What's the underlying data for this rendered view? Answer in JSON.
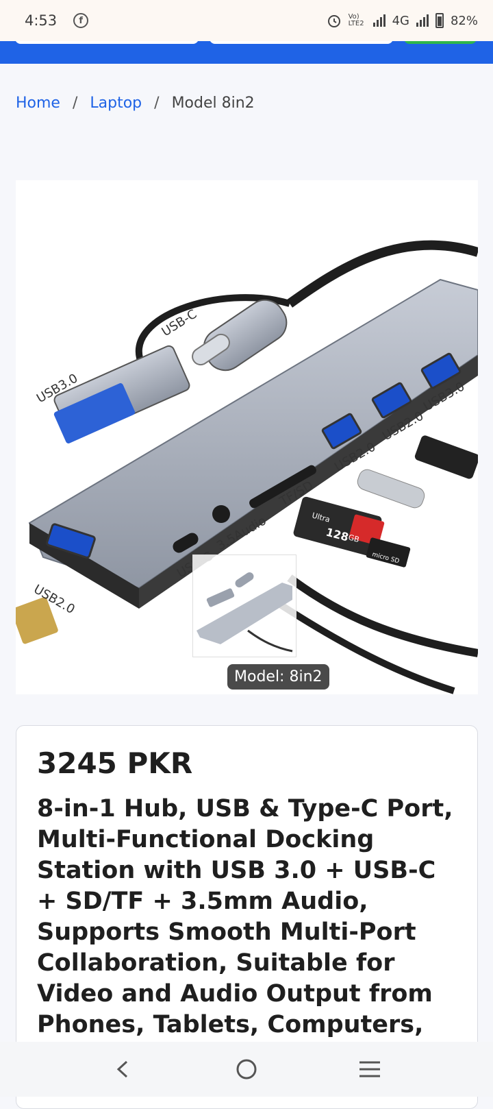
{
  "status": {
    "time": "4:53",
    "fb": "f",
    "volte": "Vo) LTE2",
    "network": "4G",
    "battery": "82%"
  },
  "breadcrumb": {
    "home": "Home",
    "laptop": "Laptop",
    "current": "Model 8in2",
    "sep": "/"
  },
  "product": {
    "image_labels": {
      "usb3_plug": "USB3.0",
      "usbc_plug": "USB-C",
      "port_usb2_left": "USB2.0",
      "port_usbc": "USB-C",
      "port_audio": "3.5Audio",
      "port_tfsd": "TF/SD",
      "port_usb2_a": "USB2.0",
      "port_usb2_b": "USB2.0",
      "port_usb3": "USB3.0",
      "sd_brand": "Ultra",
      "sd_size": "128",
      "sd_unit": "GB",
      "microsd": "micro SD"
    },
    "model_badge": "Model: 8in2",
    "price": "3245 PKR",
    "title": "8-in-1 Hub, USB & Type-C Port, Multi-Functional Docking Station with USB 3.0 + USB-C + SD/TF + 3.5mm Audio, Supports Smooth Multi-Port Collaboration, Suitable for Video and Audio Output from Phones, Tablets, Computers, Etc"
  },
  "nav": {
    "back": "back-icon",
    "home": "home-icon",
    "menu": "menu-icon"
  },
  "colors": {
    "brand_blue": "#1f63e6",
    "cta_green": "#2fb74a"
  }
}
